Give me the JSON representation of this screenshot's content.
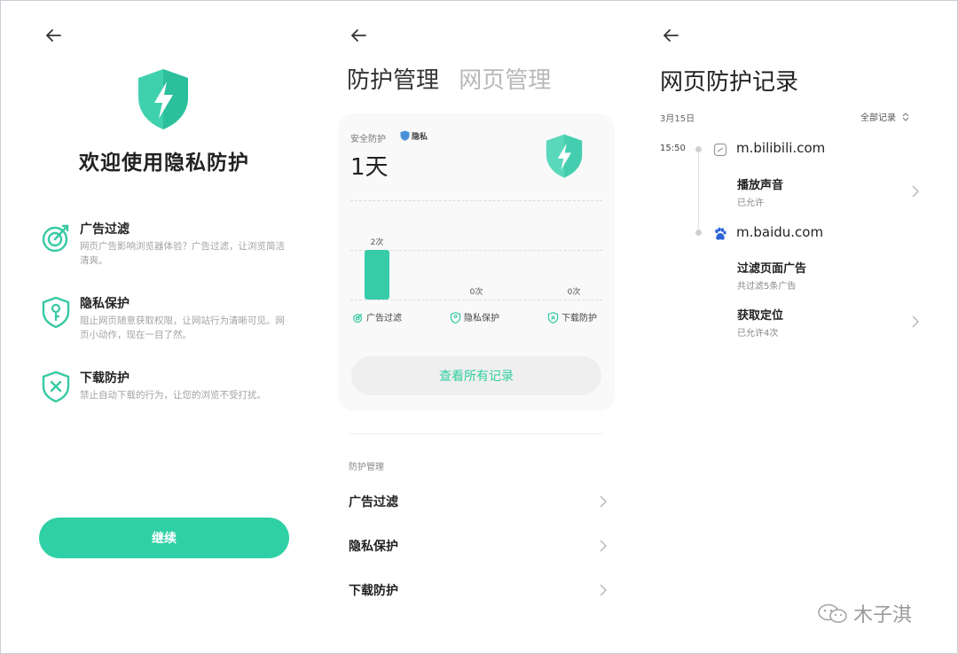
{
  "colors": {
    "accent": "#2fd0a6",
    "bar": "#37cba8",
    "muted_tab": "#b8b8b8"
  },
  "welcome_screen": {
    "title": "欢迎使用隐私防护",
    "features": [
      {
        "icon": "target-icon",
        "title": "广告过滤",
        "desc": "网页广告影响浏览器体验？广告过滤，让浏览简洁清爽。"
      },
      {
        "icon": "key-shield-icon",
        "title": "隐私保护",
        "desc": "阻止网页随意获取权限，让网站行为清晰可见。网页小动作，现在一目了然。"
      },
      {
        "icon": "x-shield-icon",
        "title": "下载防护",
        "desc": "禁止自动下载的行为，让您的浏览不受打扰。"
      }
    ],
    "continue_label": "继续"
  },
  "management_screen": {
    "tabs": [
      {
        "label": "防护管理",
        "active": true
      },
      {
        "label": "网页管理",
        "active": false
      }
    ],
    "card": {
      "label": "安全防护",
      "badge": "隐私",
      "days": "1天",
      "view_all_label": "查看所有记录"
    },
    "section_title": "防护管理",
    "menu": [
      "广告过滤",
      "隐私保护",
      "下载防护"
    ]
  },
  "chart_data": {
    "type": "bar",
    "categories": [
      "广告过滤",
      "隐私保护",
      "下载防护"
    ],
    "values": [
      2,
      0,
      0
    ],
    "value_labels": [
      "2次",
      "0次",
      "0次"
    ],
    "ylim": [
      0,
      4
    ],
    "grid": true
  },
  "records_screen": {
    "title": "网页防护记录",
    "date": "3月15日",
    "filter_label": "全部记录",
    "time": "15:50",
    "sites": [
      {
        "name": "m.bilibili.com",
        "icon": "bilibili-icon",
        "records": [
          {
            "title": "播放声音",
            "sub": "已允许",
            "chevron": true
          }
        ]
      },
      {
        "name": "m.baidu.com",
        "icon": "baidu-paw-icon",
        "records": [
          {
            "title": "过滤页面广告",
            "sub": "共过滤5条广告",
            "chevron": false
          },
          {
            "title": "获取定位",
            "sub": "已允许4次",
            "chevron": true
          }
        ]
      }
    ]
  },
  "watermark": {
    "text": "木子淇"
  }
}
